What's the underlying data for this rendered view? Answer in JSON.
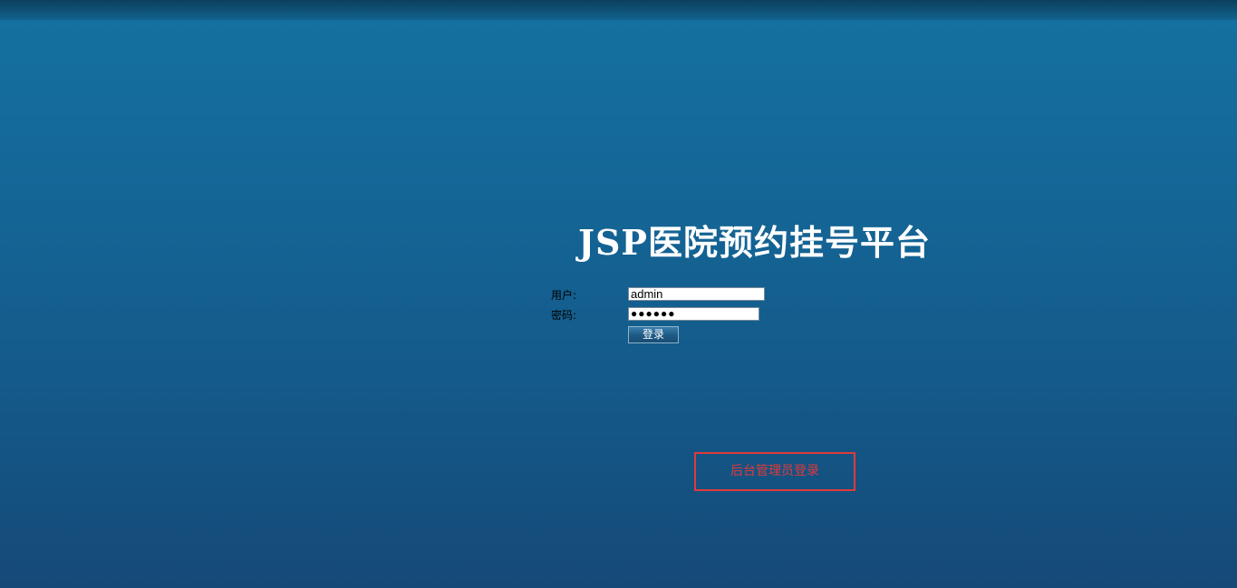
{
  "page": {
    "title": "JSP医院预约挂号平台"
  },
  "form": {
    "username_label": "用户:",
    "username_value": "admin",
    "password_label": "密码:",
    "password_mask": "●●●●●●",
    "login_button": "登录"
  },
  "admin_link": {
    "label": "后台管理员登录",
    "color": "#e03a3a"
  }
}
